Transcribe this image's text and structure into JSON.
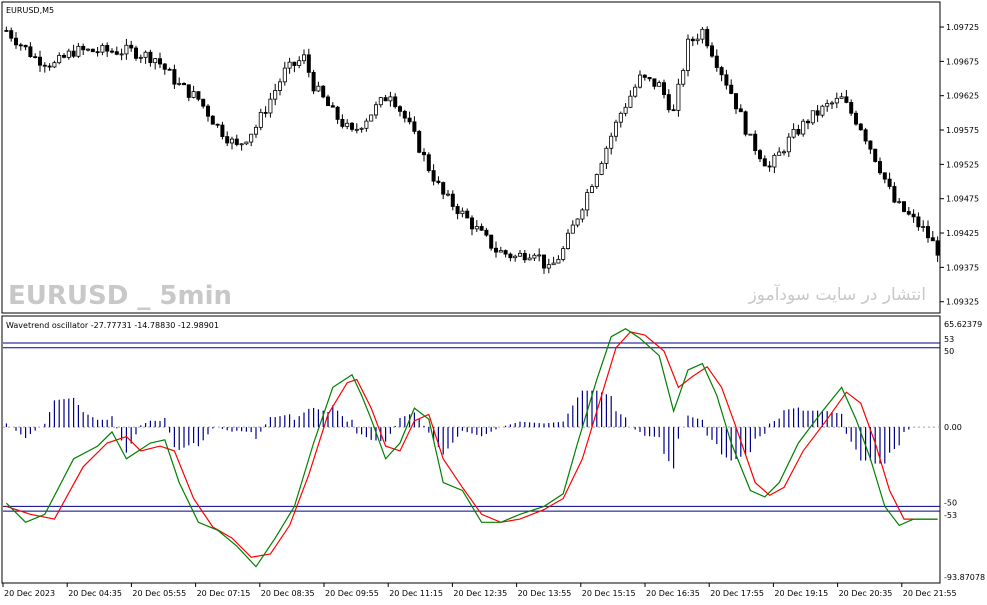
{
  "main_pane": {
    "title": "EURUSD,M5",
    "watermark_left": "EURUSD _ 5min",
    "watermark_right": "انتشار در سایت سودآموز",
    "price_ticks": [
      "1.09725",
      "1.09675",
      "1.09625",
      "1.09575",
      "1.09525",
      "1.09475",
      "1.09425",
      "1.09375",
      "1.09325"
    ]
  },
  "indicator_pane": {
    "title": "Wavetrend oscillator -27.77731 -14.78830 -12.98901",
    "top_value": "65.62379",
    "bottom_value": "-93.87078",
    "level_labels": [
      "53",
      "50",
      "0.00",
      "-50",
      "-53"
    ]
  },
  "time_axis": {
    "labels": [
      "20 Dec 2023",
      "20 Dec 04:35",
      "20 Dec 05:55",
      "20 Dec 07:15",
      "20 Dec 08:35",
      "20 Dec 09:55",
      "20 Dec 11:15",
      "20 Dec 12:35",
      "20 Dec 13:55",
      "20 Dec 15:15",
      "20 Dec 16:35",
      "20 Dec 17:55",
      "20 Dec 19:15",
      "20 Dec 20:35",
      "20 Dec 21:55"
    ]
  },
  "colors": {
    "candle": "#000000",
    "wt1_line": "#008000",
    "wt2_line": "#ff0000",
    "histogram": "#00008b",
    "level_lines": "#00008b",
    "zero_line": "#a0a0a0",
    "border": "#000000"
  },
  "chart_data": [
    {
      "type": "candlestick",
      "title": "EURUSD,M5",
      "ylim": [
        1.0931,
        1.0976
      ],
      "ytick_labels": [
        "1.09725",
        "1.09675",
        "1.09625",
        "1.09575",
        "1.09525",
        "1.09475",
        "1.09425",
        "1.09375",
        "1.09325"
      ],
      "close_path": [
        [
          0,
          1.0972
        ],
        [
          6,
          1.0968
        ],
        [
          10,
          1.0967
        ],
        [
          14,
          1.0969
        ],
        [
          20,
          1.0969
        ],
        [
          26,
          1.0969
        ],
        [
          31,
          1.0968
        ],
        [
          36,
          1.0964
        ],
        [
          40,
          1.0962
        ],
        [
          44,
          1.0958
        ],
        [
          48,
          1.0955
        ],
        [
          52,
          1.0958
        ],
        [
          55,
          1.0962
        ],
        [
          58,
          1.0966
        ],
        [
          62,
          1.0968
        ],
        [
          64,
          1.0964
        ],
        [
          68,
          1.096
        ],
        [
          72,
          1.0957
        ],
        [
          76,
          1.096
        ],
        [
          80,
          1.0963
        ],
        [
          84,
          1.0958
        ],
        [
          88,
          1.0952
        ],
        [
          91,
          1.0948
        ],
        [
          94,
          1.0946
        ],
        [
          98,
          1.0943
        ],
        [
          102,
          1.094
        ],
        [
          106,
          1.0939
        ],
        [
          110,
          1.094
        ],
        [
          113,
          1.0937
        ],
        [
          116,
          1.094
        ],
        [
          119,
          1.0945
        ],
        [
          122,
          1.095
        ],
        [
          125,
          1.0955
        ],
        [
          128,
          1.096
        ],
        [
          132,
          1.0965
        ],
        [
          136,
          1.0964
        ],
        [
          139,
          1.096
        ],
        [
          142,
          1.097
        ],
        [
          145,
          1.0972
        ],
        [
          147,
          1.0969
        ],
        [
          151,
          1.0963
        ],
        [
          155,
          1.0956
        ],
        [
          159,
          1.0952
        ],
        [
          163,
          1.0956
        ],
        [
          167,
          1.0959
        ],
        [
          171,
          1.0961
        ],
        [
          174,
          1.0962
        ],
        [
          178,
          1.0958
        ],
        [
          182,
          1.0952
        ],
        [
          185,
          1.0947
        ],
        [
          188,
          1.0945
        ],
        [
          191,
          1.0943
        ],
        [
          194,
          1.094
        ]
      ]
    },
    {
      "type": "line",
      "title": "Wavetrend oscillator -27.77731 -14.78830 -12.98901",
      "ylim": [
        -93.87078,
        65.62379
      ],
      "levels": [
        53,
        50,
        0,
        -50,
        -53
      ],
      "series": [
        {
          "name": "wt1",
          "points": [
            [
              0,
              -48
            ],
            [
              4,
              -60
            ],
            [
              8,
              -55
            ],
            [
              14,
              -20
            ],
            [
              19,
              -12
            ],
            [
              22,
              -3
            ],
            [
              25,
              -20
            ],
            [
              30,
              -10
            ],
            [
              33,
              -8
            ],
            [
              36,
              -35
            ],
            [
              40,
              -60
            ],
            [
              44,
              -65
            ],
            [
              48,
              -75
            ],
            [
              52,
              -88
            ],
            [
              56,
              -70
            ],
            [
              60,
              -50
            ],
            [
              64,
              -10
            ],
            [
              68,
              25
            ],
            [
              72,
              33
            ],
            [
              74,
              20
            ],
            [
              76,
              5
            ],
            [
              79,
              -20
            ],
            [
              82,
              -10
            ],
            [
              85,
              12
            ],
            [
              88,
              5
            ],
            [
              91,
              -35
            ],
            [
              95,
              -40
            ],
            [
              99,
              -60
            ],
            [
              103,
              -60
            ],
            [
              107,
              -55
            ],
            [
              112,
              -50
            ],
            [
              116,
              -42
            ],
            [
              119,
              -10
            ],
            [
              123,
              30
            ],
            [
              126,
              57
            ],
            [
              129,
              62
            ],
            [
              132,
              56
            ],
            [
              136,
              45
            ],
            [
              139,
              10
            ],
            [
              142,
              36
            ],
            [
              145,
              40
            ],
            [
              148,
              20
            ],
            [
              151,
              -10
            ],
            [
              155,
              -40
            ],
            [
              158,
              -44
            ],
            [
              161,
              -35
            ],
            [
              165,
              -10
            ],
            [
              170,
              10
            ],
            [
              174,
              25
            ],
            [
              177,
              5
            ],
            [
              180,
              -20
            ],
            [
              183,
              -50
            ],
            [
              186,
              -62
            ],
            [
              189,
              -58
            ],
            [
              194,
              -58
            ]
          ]
        },
        {
          "name": "wt2",
          "points": [
            [
              0,
              -50
            ],
            [
              5,
              -55
            ],
            [
              10,
              -58
            ],
            [
              16,
              -25
            ],
            [
              21,
              -10
            ],
            [
              25,
              -6
            ],
            [
              28,
              -15
            ],
            [
              32,
              -12
            ],
            [
              35,
              -15
            ],
            [
              39,
              -45
            ],
            [
              43,
              -63
            ],
            [
              47,
              -70
            ],
            [
              51,
              -82
            ],
            [
              55,
              -80
            ],
            [
              59,
              -62
            ],
            [
              63,
              -30
            ],
            [
              67,
              8
            ],
            [
              71,
              28
            ],
            [
              73,
              30
            ],
            [
              76,
              12
            ],
            [
              79,
              -12
            ],
            [
              82,
              -15
            ],
            [
              85,
              4
            ],
            [
              88,
              8
            ],
            [
              91,
              -20
            ],
            [
              95,
              -38
            ],
            [
              99,
              -55
            ],
            [
              103,
              -60
            ],
            [
              107,
              -58
            ],
            [
              112,
              -52
            ],
            [
              116,
              -45
            ],
            [
              120,
              -20
            ],
            [
              124,
              20
            ],
            [
              127,
              50
            ],
            [
              130,
              60
            ],
            [
              133,
              58
            ],
            [
              137,
              48
            ],
            [
              140,
              25
            ],
            [
              143,
              32
            ],
            [
              146,
              38
            ],
            [
              149,
              25
            ],
            [
              152,
              0
            ],
            [
              156,
              -35
            ],
            [
              159,
              -43
            ],
            [
              162,
              -38
            ],
            [
              166,
              -15
            ],
            [
              171,
              5
            ],
            [
              175,
              22
            ],
            [
              178,
              15
            ],
            [
              181,
              -10
            ],
            [
              184,
              -40
            ],
            [
              187,
              -58
            ],
            [
              190,
              -58
            ],
            [
              194,
              -58
            ]
          ]
        }
      ]
    }
  ]
}
